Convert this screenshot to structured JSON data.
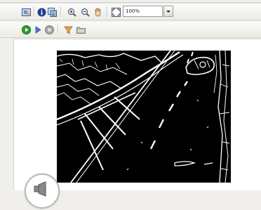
{
  "toolbar": {
    "zoom_value": "100%",
    "row1_icons": [
      "image-icon",
      "info-icon",
      "image-properties-icon",
      "zoom-in-icon",
      "zoom-out-icon",
      "hand-pan-icon",
      "fit-to-window-icon"
    ],
    "row2_icons": [
      "play-icon",
      "step-forward-icon",
      "stop-icon",
      "filter-icon",
      "folder-icon"
    ]
  },
  "colors": {
    "toolbar_bg": "#efeeea",
    "image_bg": "#000000",
    "play_green": "#2e9c2e",
    "info_blue": "#1c3f8c"
  }
}
